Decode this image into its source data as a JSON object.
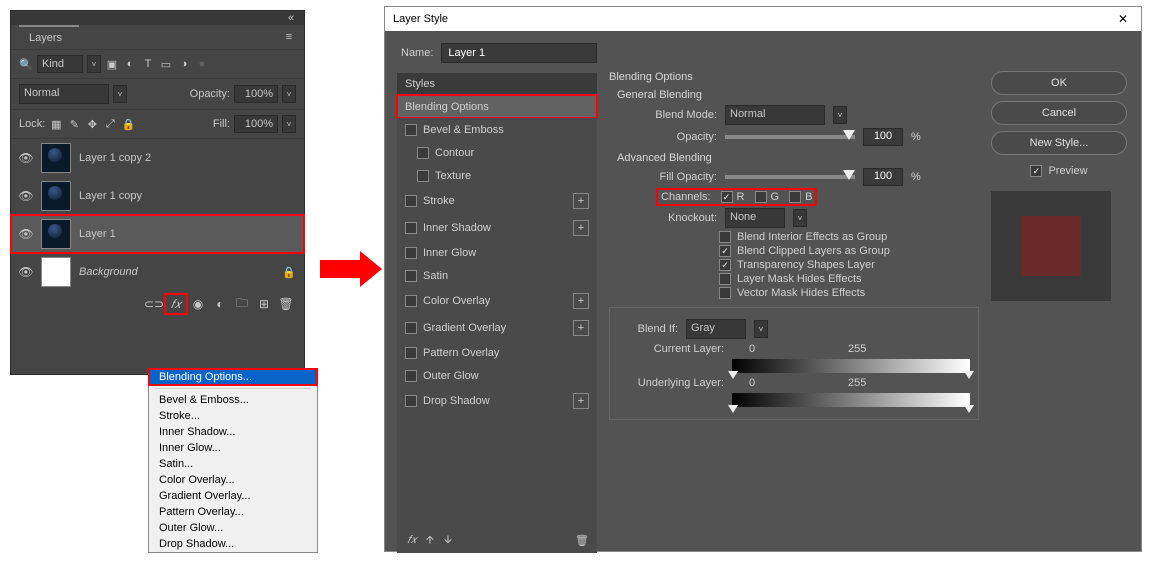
{
  "layers_panel": {
    "tab": "Layers",
    "collapse_glyph": "«",
    "menu_glyph": "≡",
    "filter_label": "Kind",
    "filter_chev": "˅",
    "filter_icons": [
      "▣",
      "◐",
      "T",
      "▭",
      "◑",
      "● "
    ],
    "blend_mode": "Normal",
    "blend_chev": "˅",
    "opacity_label": "Opacity:",
    "opacity_value": "100%",
    "opacity_chev": "˅",
    "lock_label": "Lock:",
    "lock_icons": [
      "▦",
      "✎",
      "✥",
      "⤢",
      "🔒"
    ],
    "fill_label": "Fill:",
    "fill_value": "100%",
    "fill_chev": "˅",
    "layers": [
      {
        "name": "Layer 1 copy 2",
        "visible": true
      },
      {
        "name": "Layer 1 copy",
        "visible": true
      },
      {
        "name": "Layer 1",
        "visible": true,
        "selected": true
      },
      {
        "name": "Background",
        "visible": true,
        "locked": true,
        "bg": true,
        "italic": true
      }
    ],
    "footer_icons": [
      "⊂⊃",
      "𝑓𝑥",
      "◉",
      "◐",
      "🗀",
      "⊞",
      "🗑"
    ]
  },
  "fx_menu": {
    "items": [
      "Blending Options...",
      "Bevel & Emboss...",
      "Stroke...",
      "Inner Shadow...",
      "Inner Glow...",
      "Satin...",
      "Color Overlay...",
      "Gradient Overlay...",
      "Pattern Overlay...",
      "Outer Glow...",
      "Drop Shadow..."
    ]
  },
  "dialog": {
    "title": "Layer Style",
    "close_glyph": "✕",
    "name_label": "Name:",
    "name_value": "Layer 1",
    "styles_header": "Styles",
    "styles": [
      {
        "label": "Blending Options",
        "selected": true
      },
      {
        "label": "Bevel & Emboss",
        "cb": true
      },
      {
        "label": "Contour",
        "cb": true,
        "indent": true
      },
      {
        "label": "Texture",
        "cb": true,
        "indent": true
      },
      {
        "label": "Stroke",
        "cb": true,
        "plus": true
      },
      {
        "label": "Inner Shadow",
        "cb": true,
        "plus": true
      },
      {
        "label": "Inner Glow",
        "cb": true
      },
      {
        "label": "Satin",
        "cb": true
      },
      {
        "label": "Color Overlay",
        "cb": true,
        "plus": true
      },
      {
        "label": "Gradient Overlay",
        "cb": true,
        "plus": true
      },
      {
        "label": "Pattern Overlay",
        "cb": true
      },
      {
        "label": "Outer Glow",
        "cb": true
      },
      {
        "label": "Drop Shadow",
        "cb": true,
        "plus": true
      }
    ],
    "styles_foot": {
      "fx": "𝑓𝑥",
      "up": "🡩",
      "down": "🡫",
      "trash": "🗑"
    },
    "blending": {
      "header": "Blending Options",
      "general_hd": "General Blending",
      "blend_mode_label": "Blend Mode:",
      "blend_mode_value": "Normal",
      "opacity_label": "Opacity:",
      "opacity_value": "100",
      "pct": "%",
      "advanced_hd": "Advanced Blending",
      "fill_opacity_label": "Fill Opacity:",
      "fill_opacity_value": "100",
      "channels_label": "Channels:",
      "channels": [
        {
          "label": "R",
          "on": true
        },
        {
          "label": "G",
          "on": false
        },
        {
          "label": "B",
          "on": false
        }
      ],
      "knockout_label": "Knockout:",
      "knockout_value": "None",
      "adv_checks": [
        {
          "label": "Blend Interior Effects as Group",
          "on": false
        },
        {
          "label": "Blend Clipped Layers as Group",
          "on": true
        },
        {
          "label": "Transparency Shapes Layer",
          "on": true
        },
        {
          "label": "Layer Mask Hides Effects",
          "on": false
        },
        {
          "label": "Vector Mask Hides Effects",
          "on": false
        }
      ],
      "blendif_label": "Blend If:",
      "blendif_value": "Gray",
      "current_label": "Current Layer:",
      "current_min": "0",
      "current_max": "255",
      "under_label": "Underlying Layer:",
      "under_min": "0",
      "under_max": "255"
    },
    "buttons": {
      "ok": "OK",
      "cancel": "Cancel",
      "new_style": "New Style..."
    },
    "preview_label": "Preview",
    "blendif_chev": "˅"
  }
}
